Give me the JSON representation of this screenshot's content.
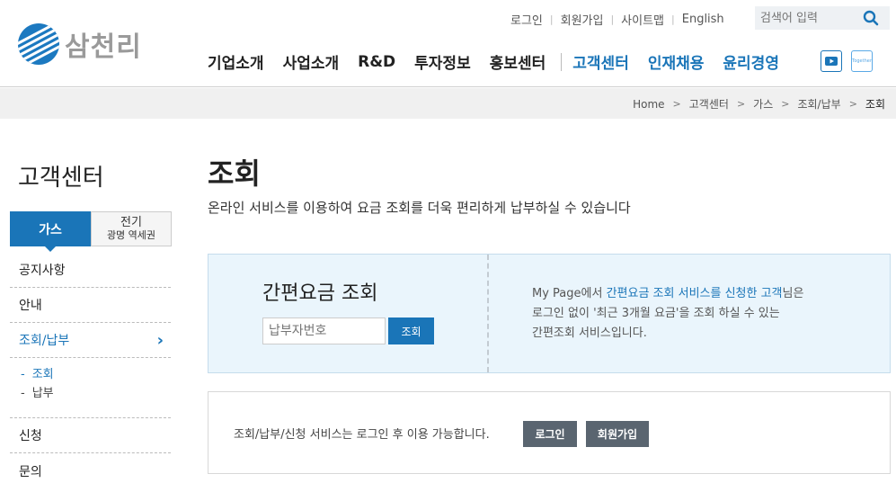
{
  "brand": {
    "logo_text": "삼천리"
  },
  "util_links": [
    "로그인",
    "회원가입",
    "사이트맵",
    "English"
  ],
  "search": {
    "placeholder": "검색어 입력"
  },
  "gnb": {
    "dark": [
      "기업소개",
      "사업소개",
      "R&D",
      "투자정보",
      "홍보센터"
    ],
    "blue": [
      "고객센터",
      "인재채용",
      "윤리경영"
    ]
  },
  "sns": {
    "tg_label": "Together"
  },
  "breadcrumb": [
    "Home",
    "고객센터",
    "가스",
    "조회/납부",
    "조회"
  ],
  "sidebar": {
    "title": "고객센터",
    "tab_gas": "가스",
    "tab_elec_1": "전기",
    "tab_elec_2": "광명 역세권",
    "items": [
      "공지사항",
      "안내",
      "조회/납부",
      "신청",
      "문의"
    ],
    "sub_items": [
      "조회",
      "납부"
    ],
    "sub_dash": "-",
    "chevron": "›"
  },
  "main": {
    "title": "조회",
    "description": "온라인 서비스를 이용하여 요금 조회를 더욱 편리하게 납부하실 수 있습니다",
    "quick": {
      "title": "간편요금 조회",
      "input_placeholder": "납부자번호",
      "button": "조회",
      "info_pre": "My Page에서 ",
      "info_hl": "간편요금 조회 서비스를 신청한 고객",
      "info_post": "님은",
      "info_line2": "로그인 없이 '최근 3개월 요금'을 조회 하실 수 있는",
      "info_line3": "간편조회 서비스입니다."
    },
    "login_notice": {
      "text": "조회/납부/신청 서비스는 로그인 후 이용 가능합니다.",
      "login_button": "로그인",
      "join_button": "회원가입"
    }
  },
  "colors": {
    "accent": "#1a75b8",
    "gray_button": "#5a6570",
    "info_bg": "#eaf5fc"
  }
}
